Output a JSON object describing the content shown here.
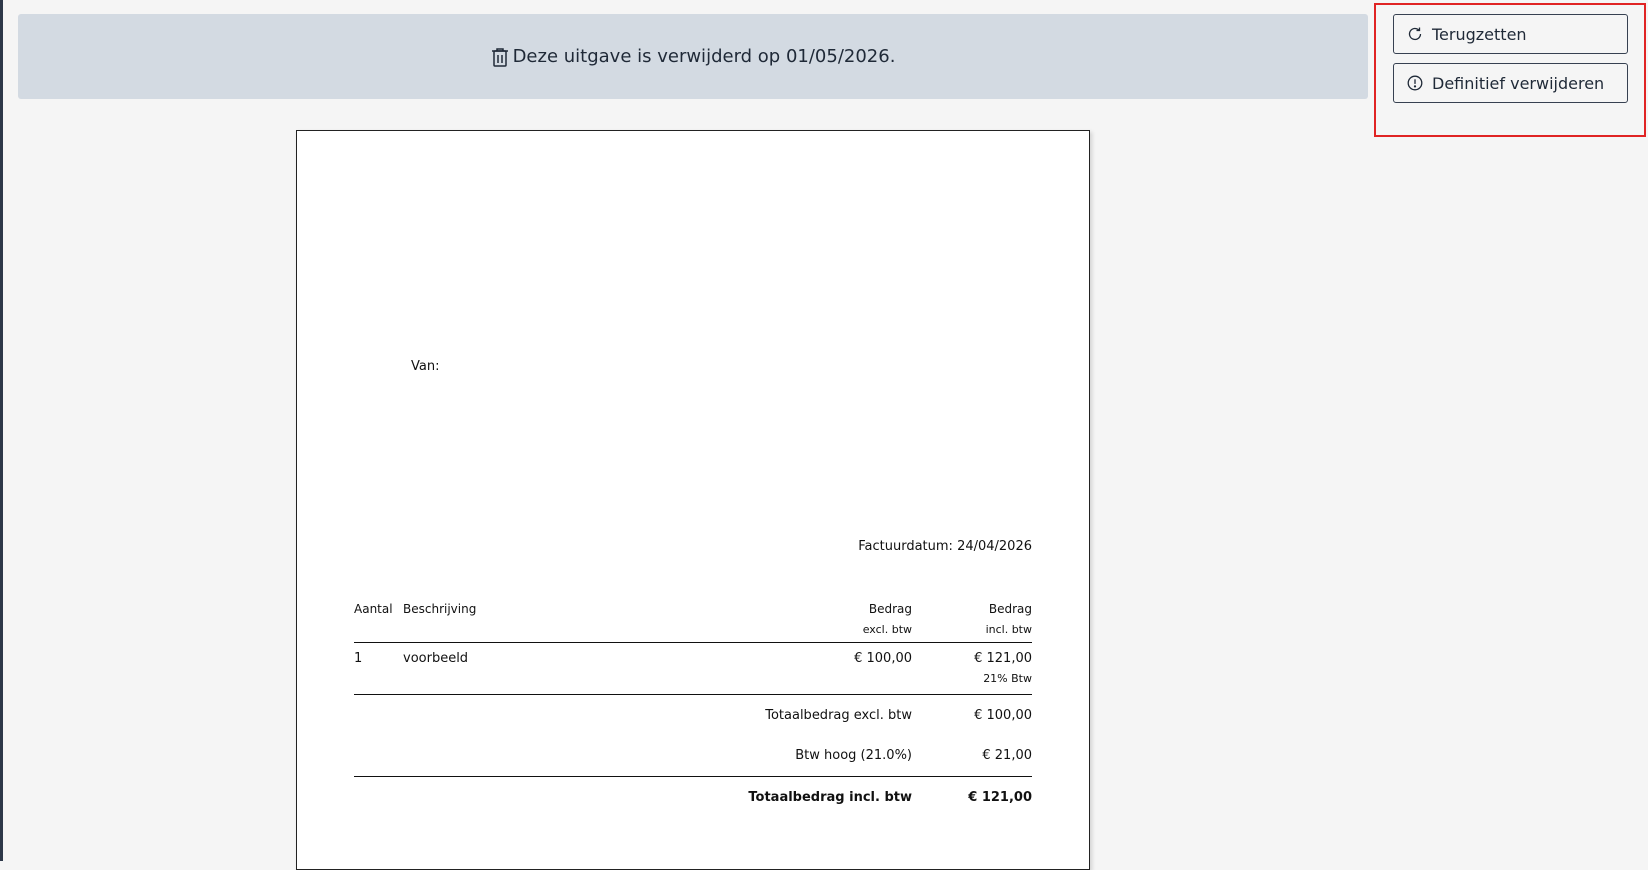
{
  "banner": {
    "icon": "trash-icon",
    "text": "Deze uitgave is verwijderd op 01/05/2026."
  },
  "actions": {
    "restore_label": "Terugzetten",
    "restore_icon": "refresh-icon",
    "delete_label": "Definitief verwijderen",
    "delete_icon": "alert-circle-icon",
    "highlight_color": "#e02424"
  },
  "invoice": {
    "from_label": "Van:",
    "date_label": "Factuurdatum: 24/04/2026",
    "columns": {
      "qty": "Aantal",
      "description": "Beschrijving",
      "excl_line1": "Bedrag",
      "excl_line2": "excl. btw",
      "incl_line1": "Bedrag",
      "incl_line2": "incl. btw"
    },
    "lines": [
      {
        "qty": "1",
        "description": "voorbeeld",
        "amount_excl": "€ 100,00",
        "amount_incl": "€ 121,00",
        "vat_rate": "21% Btw"
      }
    ],
    "totals": {
      "excl_label": "Totaalbedrag excl. btw",
      "excl_value": "€ 100,00",
      "vat_label": "Btw hoog (21.0%)",
      "vat_value": "€ 21,00",
      "incl_label": "Totaalbedrag incl. btw",
      "incl_value": "€ 121,00"
    }
  }
}
